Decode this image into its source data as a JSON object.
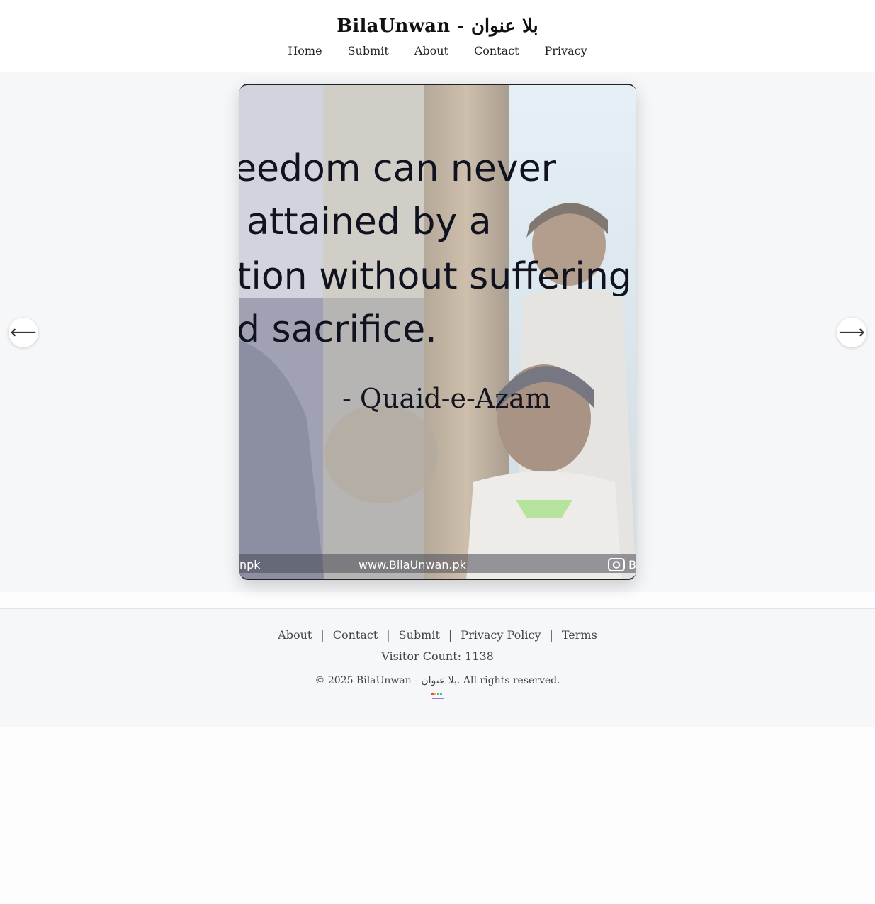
{
  "site": {
    "title": "BilaUnwan - بلا عنوان"
  },
  "nav": {
    "items": [
      {
        "label": "Home"
      },
      {
        "label": "Submit"
      },
      {
        "label": "About"
      },
      {
        "label": "Contact"
      },
      {
        "label": "Privacy"
      }
    ]
  },
  "post_image": {
    "quote_lines": [
      "eedom can never",
      "attained by a",
      "tion without suffering",
      "d sacrifice."
    ],
    "attribution": "- Quaid-e-Azam",
    "watermark_left": "npk",
    "watermark_center": "www.BilaUnwan.pk",
    "watermark_right": "B",
    "instagram_icon": "instagram-icon"
  },
  "arrows": {
    "prev": "⟵",
    "next": "⟶"
  },
  "footer": {
    "links": [
      {
        "label": "About"
      },
      {
        "label": "Contact"
      },
      {
        "label": "Submit"
      },
      {
        "label": "Privacy Policy"
      },
      {
        "label": "Terms"
      }
    ],
    "separator": "|",
    "visitor_count": "Visitor Count: 1138",
    "copyright": "© 2025 BilaUnwan - بلا عنوان. All rights reserved."
  },
  "colors": {
    "page_bg": "#f6f7f9",
    "header_bg": "#ffffff",
    "text": "#222222"
  }
}
